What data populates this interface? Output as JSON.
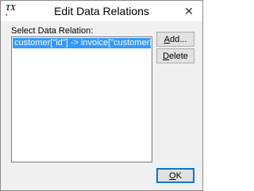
{
  "window": {
    "title": "Edit Data Relations",
    "app_icon": "tx-app-icon",
    "close_symbol": "✕"
  },
  "dialog": {
    "list_label": "Select Data Relation:",
    "relations": [
      "customer[\"id\"] -> invoice[\"customerID\"]"
    ],
    "selected_index": 0,
    "add_button": {
      "accel": "A",
      "rest": "dd..."
    },
    "delete_button": {
      "accel": "D",
      "rest": "elete"
    },
    "ok_button": {
      "accel": "O",
      "rest": "K"
    }
  }
}
